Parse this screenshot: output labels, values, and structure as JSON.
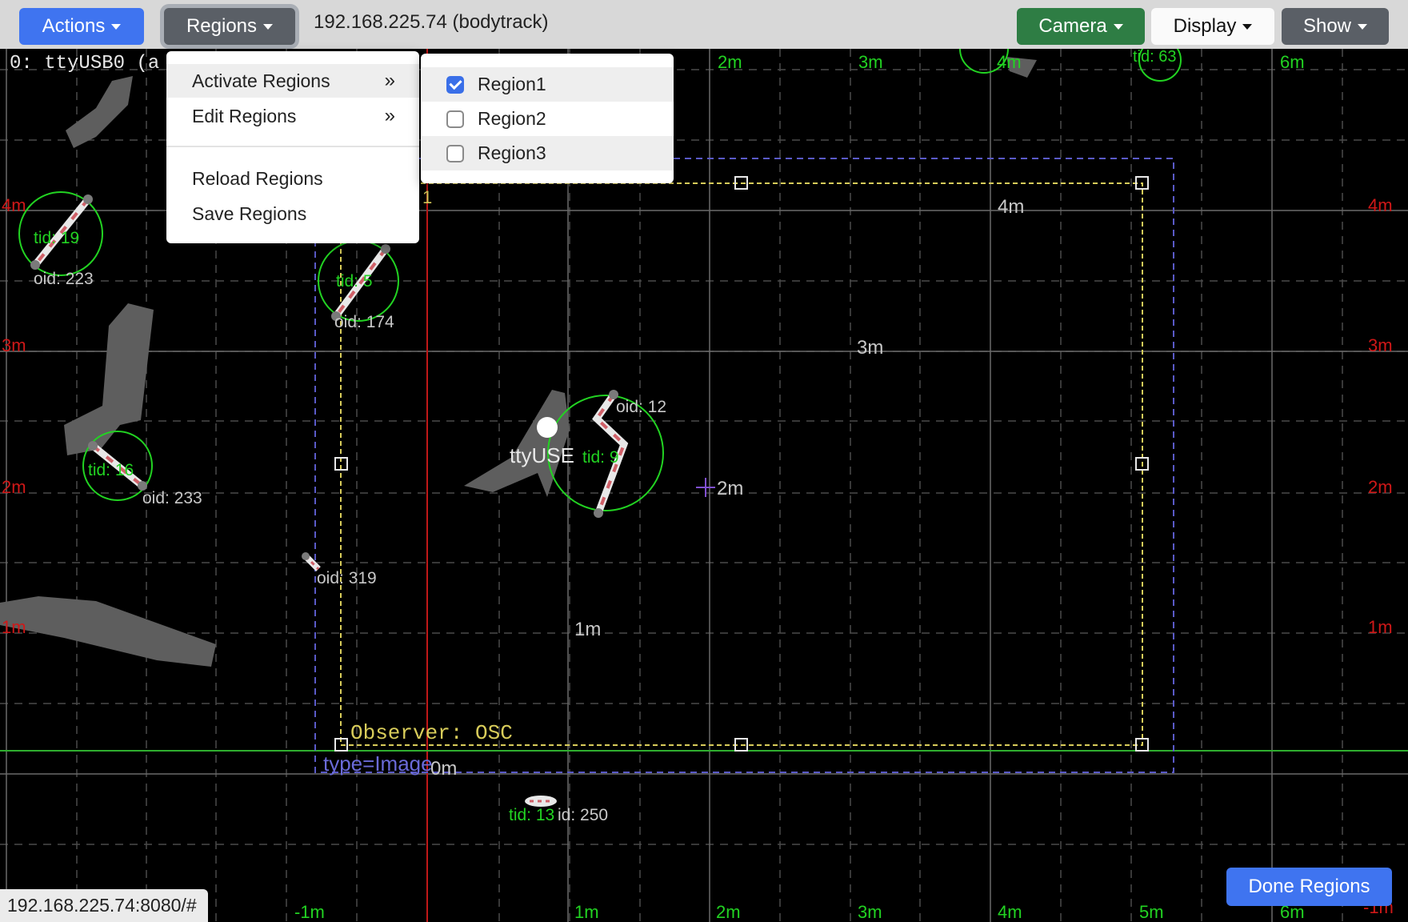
{
  "toolbar": {
    "actions_label": "Actions",
    "regions_label": "Regions",
    "host_title": "192.168.225.74 (bodytrack)",
    "camera_label": "Camera",
    "display_label": "Display",
    "show_label": "Show"
  },
  "regions_menu": {
    "items": [
      {
        "label": "Activate Regions",
        "arrow": "»"
      },
      {
        "label": "Edit Regions",
        "arrow": "»"
      },
      {
        "label": "Reload Regions"
      },
      {
        "label": "Save Regions"
      }
    ]
  },
  "activate_submenu": {
    "items": [
      {
        "label": "Region1",
        "checked": true
      },
      {
        "label": "Region2",
        "checked": false
      },
      {
        "label": "Region3",
        "checked": false
      }
    ]
  },
  "canvas": {
    "sensor_label": "0: ttyUSB0 (a",
    "sensor_marker_label": "ttyUSE",
    "region_marker_label": "1",
    "observer_label": "Observer: OSC",
    "type_label": "type=Image",
    "axis_left_labels": [
      "4m",
      "3m",
      "2m",
      "1m"
    ],
    "axis_right_labels": [
      "4m",
      "3m",
      "2m",
      "1m",
      "-1m"
    ],
    "axis_top_labels": [
      "2m",
      "3m",
      "4m",
      "6m"
    ],
    "axis_bottom_labels": [
      "-1m",
      "1m",
      "2m",
      "3m",
      "4m",
      "5m",
      "6m"
    ],
    "inner_labels": [
      "4m",
      "3m",
      "2m",
      "1m",
      "0m"
    ],
    "tracks": [
      {
        "tid": "tid: 19",
        "oid": "oid: 223"
      },
      {
        "tid": "tid: 5",
        "oid": "oid: 174"
      },
      {
        "tid": "tid: 9",
        "oid": "oid: 12"
      },
      {
        "tid": "tid: 16",
        "oid": "oid: 233"
      },
      {
        "tid": "tid: 63",
        "oid": ""
      },
      {
        "tid": "tid: 13",
        "oid": "id: 250"
      }
    ],
    "lone_oid": "oid: 319"
  },
  "status": {
    "url": "192.168.225.74:8080/#",
    "done_label": "Done Regions"
  },
  "colors": {
    "primary": "#3f74f0",
    "secondary": "#5a5f66",
    "success": "#2e7d44",
    "axis_red": "#d01818",
    "track_green": "#22d322",
    "region_yellow": "#d8cc5a",
    "region_bounds_blue": "#5a5ac8"
  }
}
